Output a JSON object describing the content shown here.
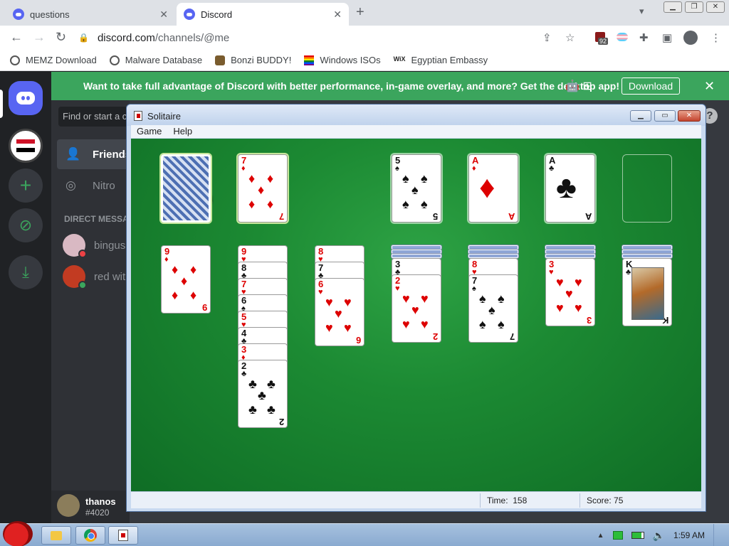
{
  "browser": {
    "tabs": [
      {
        "title": "questions",
        "active": false
      },
      {
        "title": "Discord",
        "active": true
      }
    ],
    "new_tab_label": "+",
    "url": {
      "host": "discord.com",
      "path": "/channels/@me"
    },
    "extension_badge": "92",
    "bookmarks": [
      {
        "label": "MEMZ Download",
        "icon": "globe-icon"
      },
      {
        "label": "Malware Database",
        "icon": "globe-icon"
      },
      {
        "label": "Bonzi BUDDY!",
        "icon": "bonzi-icon"
      },
      {
        "label": "Windows ISOs",
        "icon": "rainbow-flag-icon"
      },
      {
        "label": "Egyptian Embassy",
        "icon": "wix-icon",
        "glyph": "WiX"
      }
    ]
  },
  "discord": {
    "banner": {
      "message": "Want to take full advantage of Discord with better performance, in-game overlay, and more? Get the desktop app!",
      "download_label": "Download",
      "color": "#3ba55d"
    },
    "search_placeholder": "Find or start a c",
    "nav": [
      {
        "label": "Friends",
        "icon": "friends-icon",
        "selected": true
      },
      {
        "label": "Nitro",
        "icon": "nitro-icon",
        "selected": false
      }
    ],
    "dm_header": "DIRECT MESSA",
    "dms": [
      {
        "name": "bingus",
        "status": "dnd"
      },
      {
        "name": "red wit",
        "status": "online"
      }
    ],
    "user": {
      "name": "thanos",
      "tag": "#4020"
    },
    "help_glyph": "?"
  },
  "solitaire": {
    "window_title": "Solitaire",
    "menu": [
      "Game",
      "Help"
    ],
    "status": {
      "time_label": "Time:",
      "time_value": "158",
      "score_label": "Score:",
      "score_value": "75"
    },
    "stock": {
      "face_down": true
    },
    "waste": {
      "rank": "7",
      "suit": "♦"
    },
    "foundations": [
      {
        "rank": "5",
        "suit": "♠"
      },
      {
        "rank": "A",
        "suit": "♦"
      },
      {
        "rank": "A",
        "suit": "♣"
      },
      {
        "rank": "",
        "suit": ""
      }
    ],
    "tableau": [
      {
        "hidden": 0,
        "cards": [
          {
            "rank": "9",
            "suit": "♦"
          }
        ]
      },
      {
        "hidden": 0,
        "cards": [
          {
            "rank": "9",
            "suit": "♥"
          },
          {
            "rank": "8",
            "suit": "♣"
          },
          {
            "rank": "7",
            "suit": "♥"
          },
          {
            "rank": "6",
            "suit": "♠"
          },
          {
            "rank": "5",
            "suit": "♥"
          },
          {
            "rank": "4",
            "suit": "♣"
          },
          {
            "rank": "3",
            "suit": "♦"
          },
          {
            "rank": "2",
            "suit": "♣"
          }
        ]
      },
      {
        "hidden": 0,
        "cards": [
          {
            "rank": "8",
            "suit": "♥"
          },
          {
            "rank": "7",
            "suit": "♣"
          },
          {
            "rank": "6",
            "suit": "♥"
          }
        ]
      },
      {
        "hidden": 3,
        "cards": [
          {
            "rank": "3",
            "suit": "♣"
          },
          {
            "rank": "2",
            "suit": "♥"
          }
        ]
      },
      {
        "hidden": 3,
        "cards": [
          {
            "rank": "8",
            "suit": "♥"
          },
          {
            "rank": "7",
            "suit": "♠"
          }
        ]
      },
      {
        "hidden": 3,
        "cards": [
          {
            "rank": "3",
            "suit": "♥"
          }
        ]
      },
      {
        "hidden": 3,
        "cards": [
          {
            "rank": "K",
            "suit": "♣"
          }
        ]
      }
    ]
  },
  "taskbar": {
    "clock": "1:59 AM",
    "apps": [
      {
        "name": "folder-icon",
        "active": false
      },
      {
        "name": "chrome-icon",
        "active": false
      },
      {
        "name": "solitaire-icon",
        "active": true
      }
    ]
  }
}
